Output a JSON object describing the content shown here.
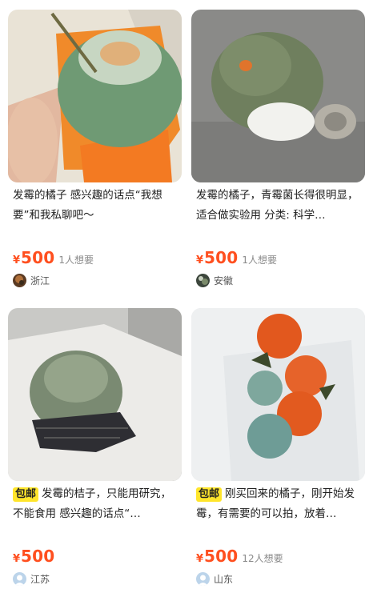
{
  "items": [
    {
      "tag": "",
      "title": "发霉的橘子 感兴趣的话点“我想要”和我私聊吧～",
      "currency": "¥",
      "price": "500",
      "want": "1人想要",
      "location": "浙江"
    },
    {
      "tag": "",
      "title": "发霉的橘子，青霉菌长得很明显，适合做实验用 分类: 科学…",
      "currency": "¥",
      "price": "500",
      "want": "1人想要",
      "location": "安徽"
    },
    {
      "tag": "包邮",
      "title": "发霉的桔子，只能用研究，不能食用 感兴趣的话点“…",
      "currency": "¥",
      "price": "500",
      "want": "",
      "location": "江苏"
    },
    {
      "tag": "包邮",
      "title": "刚买回来的橘子，刚开始发霉，有需要的可以拍，放着…",
      "currency": "¥",
      "price": "500",
      "want": "12人想要",
      "location": "山东"
    }
  ],
  "colors": {
    "price": "#ff4f1f",
    "tag_bg": "#ffe52b"
  }
}
